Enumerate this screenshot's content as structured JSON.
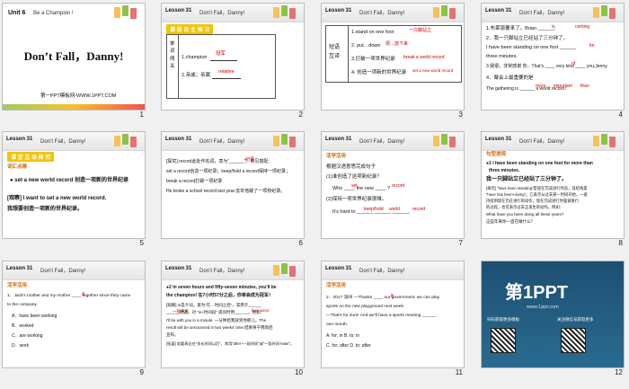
{
  "slides": [
    {
      "num": "1",
      "unit": "Unit 6",
      "unit_sub": "Be a Champion !",
      "title": "Don’t Fall，Danny!",
      "footer": "第一PPT模板网-WWW.1PPT.COM"
    },
    {
      "num": "2",
      "lesson": "Lesson 31",
      "sub": "Don’t Fall，Danny!",
      "tag": "课 前 自 主 预 习",
      "side_label": "单词闯关",
      "items": [
        "1.champion",
        "2.亲戚；亲属"
      ],
      "answers": [
        "冠军",
        "relative"
      ]
    },
    {
      "num": "3",
      "lesson": "Lesson 31",
      "sub": "Don’t Fall，Danny!",
      "side": "短语互译",
      "items": [
        "1.stand on one foot",
        "2. put…down",
        "3.打破一项世界纪录",
        "4. 创造一项新的世界纪录"
      ],
      "answers": [
        "一只脚站立",
        "把…放下来",
        "break a world record",
        "set a new world record"
      ]
    },
    {
      "num": "4",
      "lesson": "Lesson 31",
      "sub": "Don’t Fall，Danny!",
      "lines": [
        "1.布莱恩要来了。Brian ______.",
        "2．我一只脚站立已经站了三分钟了。",
        "I have been standing on one foot ______",
        "three minutes.",
        "3.我很，非常感谢 你。That's ____ very kind ____ you,Jenny.",
        "4．聚会上最重要的是",
        "The gathering is ______ a world record！"
      ],
      "answers": [
        "is",
        "coming",
        "for",
        "of",
        "more",
        "important",
        "than"
      ]
    },
    {
      "num": "5",
      "lesson": "Lesson 31",
      "sub": "Don’t Fall，Danny!",
      "tag": "课 堂 互 动 探 究",
      "sec": "词汇点睛",
      "lines": [
        "● set a new world record 创造一项新的世界纪录",
        "[观察] I want to set a new world record.",
        "我想要创造一项新的世界纪录。"
      ]
    },
    {
      "num": "6",
      "lesson": "Lesson 31",
      "sub": "Don’t Fall，Danny!",
      "lines": [
        "[探究] record此处作名词，意为“______”。常见搭配：",
        "set a record创造一项纪录；keep/hold a record保持一项纪录；",
        "break a record打破一项纪录",
        "He broke a school record last year.去年他破了一项校纪录。"
      ],
      "answers": [
        "纪录"
      ]
    },
    {
      "num": "7",
      "lesson": "Lesson 31",
      "sub": "Don’t Fall，Danny!",
      "sec": "活学活用",
      "lines": [
        "根据汉语意思完成句子",
        "(1)谁创造了这项新纪录？",
        "Who ____ the new ____ ?",
        "(2)保持一项世界纪录很难。",
        "It's hard to ______ ______ ______."
      ],
      "answers": [
        "set",
        "record",
        "keep/hold",
        "world",
        "record"
      ]
    },
    {
      "num": "8",
      "lesson": "Lesson 31",
      "sub": "Don’t Fall，Danny!",
      "sec": "句型透视",
      "lines": [
        "●1 I have been standing on one foot for more than",
        "three minutes.",
        "我一只脚站立已经站了三分钟了。",
        "[探究] “have been standing”是现在完成进行时态，其结构是",
        "“have has been+doing”。它表示从过去某一时间开始，一直",
        "持续到现在仍在进行的动作，现在完成进行时强调进行",
        "的过程，也可表示过去正发生的动作。例如：",
        "What have you been doing all these years?",
        "这些年来你一直在做什么？"
      ]
    },
    {
      "num": "9",
      "lesson": "Lesson 31",
      "sub": "Don’t Fall，Danny!",
      "sec": "活学活用",
      "lines": [
        "1．Jack's mother and my mother ____ together since they came",
        "to the company.",
        "A．have been working",
        "B．worked",
        "C．are working",
        "D．work"
      ],
      "answers": [
        "A"
      ]
    },
    {
      "num": "10",
      "lesson": "Lesson 31",
      "sub": "Don’t Fall，Danny!",
      "lines": [
        "●2  In seven hours and fifty-seven minutes, you'll be",
        "the champion! 在7小时57分之后，你将会成为冠军！",
        "[观察] in是介词，意为“在…时间之后”，常用于______",
        "______时态，对 “in+时间段” 提问时用______。例如：",
        "I'll be with you in a minute. 一分钟后我就到你那儿。The",
        "result will be announced in two weeks' time.结果将于两周后",
        "宣布。",
        "[拓展] 若要表达在“多长时间以后”，常用“after+一段时间”或“一段时间+later”。"
      ],
      "answers": [
        "一般将来",
        "how soon"
      ]
    },
    {
      "num": "11",
      "lesson": "Lesson 31",
      "sub": "Don’t Fall，Danny!",
      "sec": "活学活用",
      "lines": [
        "2．2017·滨州 —Thanks ____ our government, we can play",
        "sports on the new playground next week.",
        "—That's for sure! And we'll have a sports meeting ______",
        "one month.",
        "A. for; in         B. to; in",
        "C. for; after      D. to; after"
      ],
      "answers": [
        "B"
      ]
    },
    {
      "num": "12",
      "brand": "第1PPT",
      "brand_sub": "www.1ppt.com",
      "qr_left": "扫码获取更多模板",
      "qr_right": "关注微信号获取更多"
    }
  ]
}
